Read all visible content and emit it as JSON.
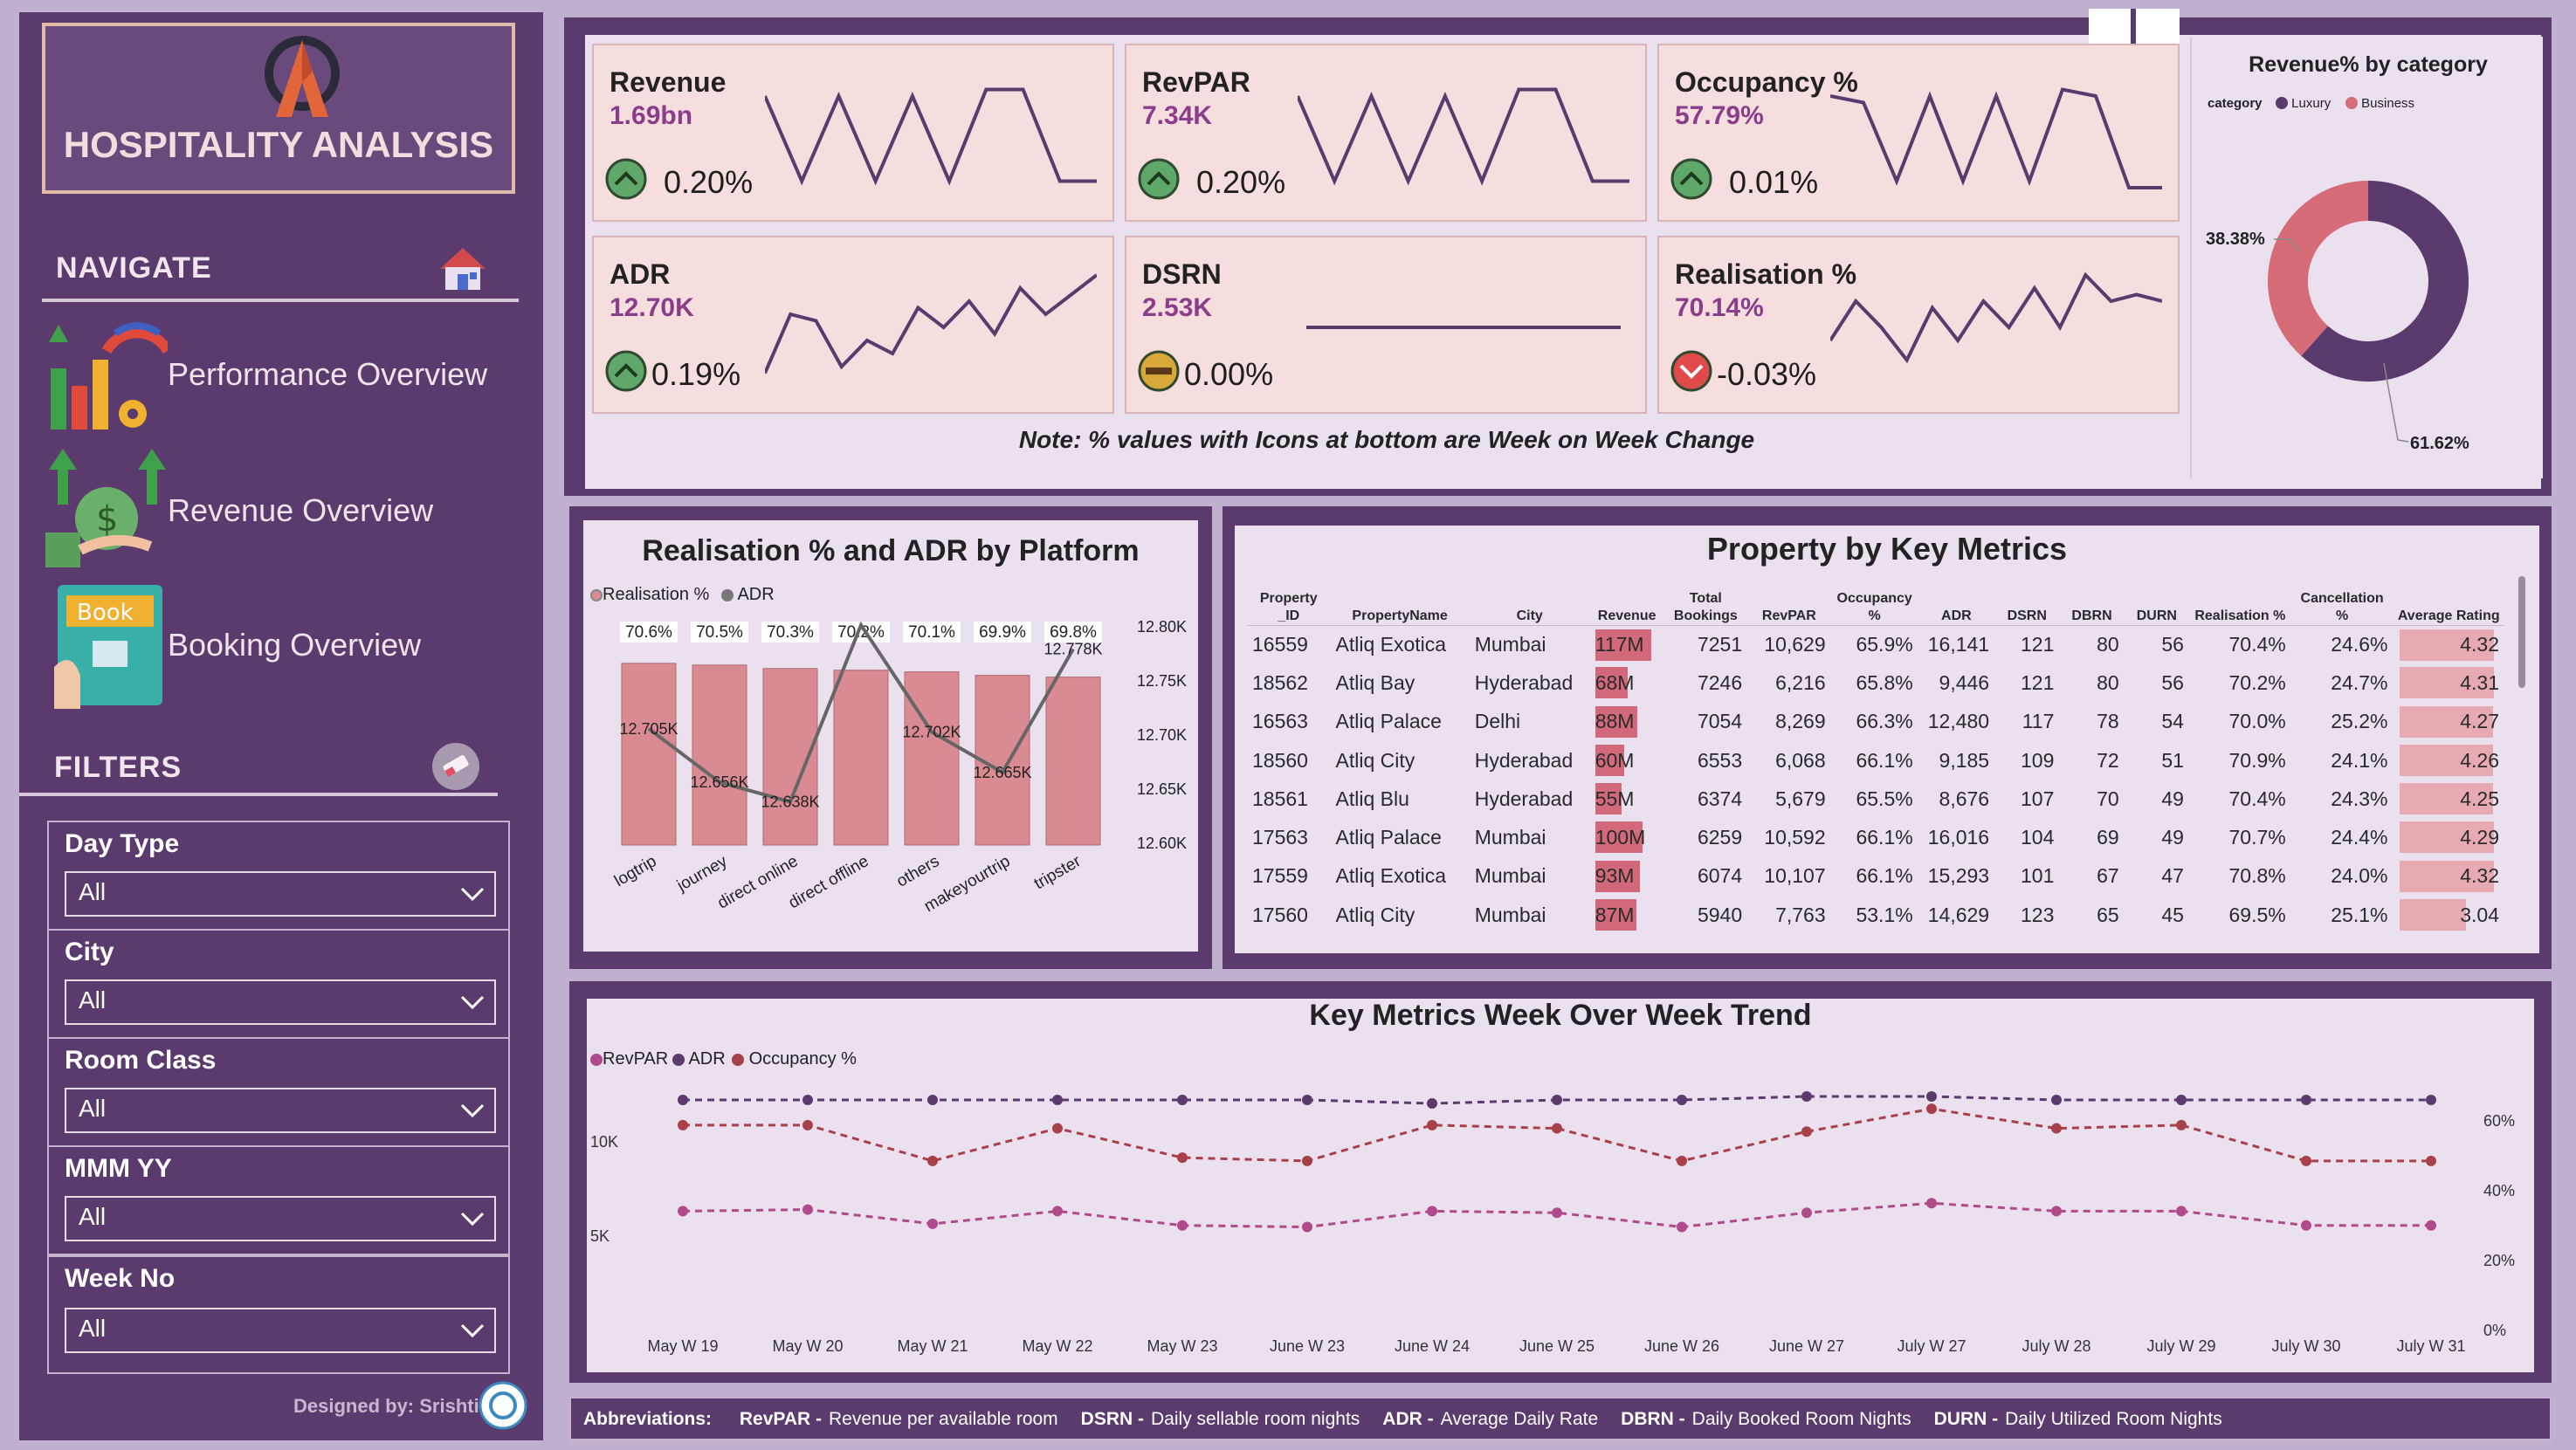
{
  "app": {
    "title": "HOSPITALITY ANALYSIS",
    "designer": "Designed by: Srishti"
  },
  "sidebar": {
    "navigate_heading": "NAVIGATE",
    "nav_items": [
      {
        "label": "Performance Overview",
        "icon": "performance-chart-icon"
      },
      {
        "label": "Revenue Overview",
        "icon": "revenue-money-icon"
      },
      {
        "label": "Booking Overview",
        "icon": "booking-book-icon"
      }
    ],
    "filters_heading": "FILTERS",
    "filters": [
      {
        "label": "Day Type",
        "value": "All"
      },
      {
        "label": "City",
        "value": "All"
      },
      {
        "label": "Room Class",
        "value": "All"
      },
      {
        "label": "MMM YY",
        "value": "All"
      },
      {
        "label": "Week No",
        "value": "All"
      }
    ]
  },
  "kpis": [
    {
      "title": "Revenue",
      "value": "1.69bn",
      "delta": "0.20%",
      "trend": "up"
    },
    {
      "title": "RevPAR",
      "value": "7.34K",
      "delta": "0.20%",
      "trend": "up"
    },
    {
      "title": "Occupancy %",
      "value": "57.79%",
      "delta": "0.01%",
      "trend": "up"
    },
    {
      "title": "ADR",
      "value": "12.70K",
      "delta": "0.19%",
      "trend": "up"
    },
    {
      "title": "DSRN",
      "value": "2.53K",
      "delta": "0.00%",
      "trend": "flat"
    },
    {
      "title": "Realisation %",
      "value": "70.14%",
      "delta": "-0.03%",
      "trend": "down"
    }
  ],
  "note": "Note: % values with Icons at bottom are Week on Week Change",
  "colors": {
    "panel": "#5b3a6e",
    "accent_pink": "#d2697a",
    "bar": "#d98a92",
    "luxury": "#5b3a6e",
    "business": "#d56c78"
  },
  "donut": {
    "title": "Revenue% by category",
    "legend_label": "category",
    "chart_data": {
      "type": "pie",
      "categories": [
        "Luxury",
        "Business"
      ],
      "values": [
        61.62,
        38.38
      ],
      "labels": [
        "61.62%",
        "38.38%"
      ]
    }
  },
  "platform_chart": {
    "title": "Realisation % and ADR by Platform",
    "legend": [
      "Realisation %",
      "ADR"
    ],
    "chart_data": {
      "type": "bar",
      "categories": [
        "logtrip",
        "journey",
        "direct online",
        "direct offline",
        "others",
        "makeyourtrip",
        "tripster"
      ],
      "series": [
        {
          "name": "Realisation %",
          "values": [
            70.6,
            70.5,
            70.3,
            70.2,
            70.1,
            69.9,
            69.8
          ],
          "labels": [
            "70.6%",
            "70.5%",
            "70.3%",
            "70.2%",
            "70.1%",
            "69.9%",
            "69.8%"
          ]
        },
        {
          "name": "ADR",
          "values": [
            12.705,
            12.656,
            12.638,
            12.8,
            12.702,
            12.665,
            12.778
          ],
          "labels": [
            "12.705K",
            "12.656K",
            "12.638K",
            "",
            "12.702K",
            "12.665K",
            "12.778K"
          ]
        }
      ],
      "y2_ticks": [
        "12.80K",
        "12.75K",
        "12.70K",
        "12.65K",
        "12.60K"
      ],
      "y2lim": [
        12.6,
        12.8
      ]
    }
  },
  "property_table": {
    "title": "Property by Key Metrics",
    "columns": [
      "Property _ID",
      "PropertyName",
      "City",
      "Revenue",
      "Total Bookings",
      "RevPAR",
      "Occupancy %",
      "ADR",
      "DSRN",
      "DBRN",
      "DURN",
      "Realisation %",
      "Cancellation %",
      "Average Rating"
    ],
    "rows": [
      [
        "16559",
        "Atliq Exotica",
        "Mumbai",
        "117M",
        "7251",
        "10,629",
        "65.9%",
        "16,141",
        "121",
        "80",
        "56",
        "70.4%",
        "24.6%",
        "4.32"
      ],
      [
        "18562",
        "Atliq Bay",
        "Hyderabad",
        "68M",
        "7246",
        "6,216",
        "65.8%",
        "9,446",
        "121",
        "80",
        "56",
        "70.2%",
        "24.7%",
        "4.31"
      ],
      [
        "16563",
        "Atliq Palace",
        "Delhi",
        "88M",
        "7054",
        "8,269",
        "66.3%",
        "12,480",
        "117",
        "78",
        "54",
        "70.0%",
        "25.2%",
        "4.27"
      ],
      [
        "18560",
        "Atliq City",
        "Hyderabad",
        "60M",
        "6553",
        "6,068",
        "66.1%",
        "9,185",
        "109",
        "72",
        "51",
        "70.9%",
        "24.1%",
        "4.26"
      ],
      [
        "18561",
        "Atliq Blu",
        "Hyderabad",
        "55M",
        "6374",
        "5,679",
        "65.5%",
        "8,676",
        "107",
        "70",
        "49",
        "70.4%",
        "24.3%",
        "4.25"
      ],
      [
        "17563",
        "Atliq Palace",
        "Mumbai",
        "100M",
        "6259",
        "10,592",
        "66.1%",
        "16,016",
        "104",
        "69",
        "49",
        "70.7%",
        "24.4%",
        "4.29"
      ],
      [
        "17559",
        "Atliq Exotica",
        "Mumbai",
        "93M",
        "6074",
        "10,107",
        "66.1%",
        "15,293",
        "101",
        "67",
        "47",
        "70.8%",
        "24.0%",
        "4.32"
      ],
      [
        "17560",
        "Atliq City",
        "Mumbai",
        "87M",
        "5940",
        "7,763",
        "53.1%",
        "14,629",
        "123",
        "65",
        "45",
        "69.5%",
        "25.1%",
        "3.04"
      ]
    ],
    "revenue_values": [
      117,
      68,
      88,
      60,
      55,
      100,
      93,
      87
    ],
    "rating_values": [
      4.32,
      4.31,
      4.27,
      4.26,
      4.25,
      4.29,
      4.32,
      3.04
    ]
  },
  "trend_chart": {
    "title": "Key Metrics Week Over Week Trend",
    "legend": [
      "RevPAR",
      "ADR",
      "Occupancy %"
    ],
    "chart_data": {
      "type": "line",
      "x": [
        "May W 19",
        "May W 20",
        "May W 21",
        "May W 22",
        "May W 23",
        "June W 23",
        "June W 24",
        "June W 25",
        "June W 26",
        "June W 27",
        "July W 27",
        "July W 28",
        "July W 29",
        "July W 30",
        "July W 31"
      ],
      "series": [
        {
          "name": "RevPAR",
          "values": [
            7300,
            7400,
            6500,
            7300,
            6400,
            6300,
            7300,
            7200,
            6300,
            7200,
            7800,
            7300,
            7300,
            6400,
            6400
          ]
        },
        {
          "name": "ADR",
          "values": [
            12700,
            12700,
            12700,
            12700,
            12700,
            12700,
            12650,
            12700,
            12700,
            12750,
            12750,
            12700,
            12700,
            12700,
            12700
          ]
        },
        {
          "name": "Occupancy %",
          "values": [
            62,
            62,
            51,
            61,
            52,
            51,
            62,
            61,
            51,
            60,
            67,
            61,
            62,
            51,
            51
          ]
        }
      ],
      "y_ticks": [
        "10K",
        "5K"
      ],
      "y2_ticks": [
        "60%",
        "40%",
        "20%",
        "0%"
      ]
    }
  },
  "footer": {
    "heading": "Abbreviations:",
    "items": [
      {
        "key": "RevPAR -",
        "text": "Revenue per available room"
      },
      {
        "key": "DSRN -",
        "text": "Daily sellable room nights"
      },
      {
        "key": "ADR -",
        "text": "Average Daily Rate"
      },
      {
        "key": "DBRN -",
        "text": "Daily Booked Room Nights"
      },
      {
        "key": "DURN -",
        "text": "Daily Utilized Room Nights"
      }
    ]
  }
}
